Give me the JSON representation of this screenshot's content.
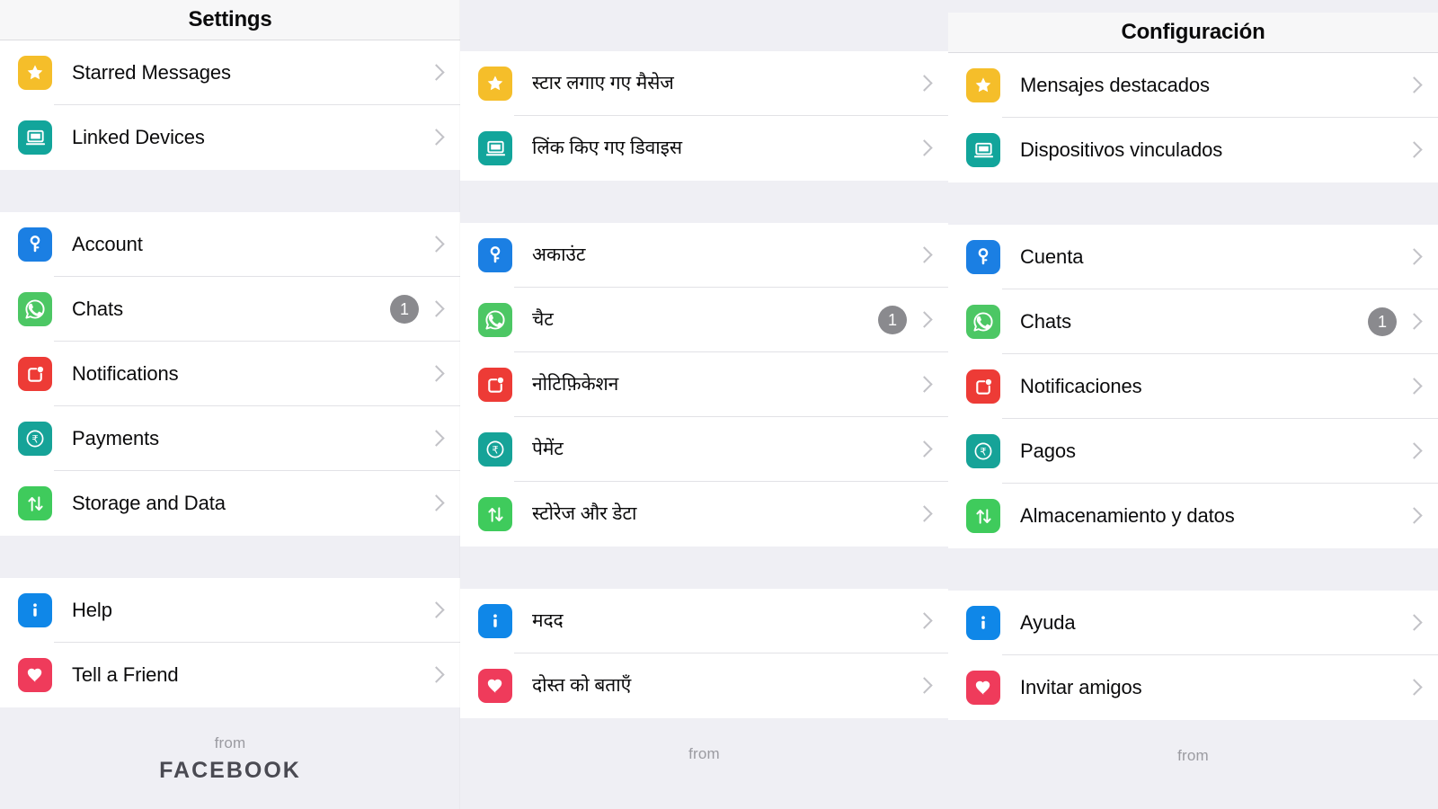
{
  "colors": {
    "page_background": "#EFEFF4",
    "row_background": "#FFFFFF",
    "separator": "#E2E2E6",
    "label_text": "#0B0B0C",
    "chevron": "#C2C2C7",
    "badge_background": "#8A8A8E",
    "badge_text": "#FFFFFF",
    "footer_from_text": "#9B9BA1",
    "footer_brand_text": "#4A4A52",
    "icon_star": "#F5BE2A",
    "icon_linked_devices": "#12A59B",
    "icon_account": "#1B7FE3",
    "icon_chats": "#4CC764",
    "icon_notifications": "#ED3B36",
    "icon_payments": "#16A398",
    "icon_storage": "#3FCB5C",
    "icon_help": "#0F87E8",
    "icon_tell_a_friend": "#EF3B5B"
  },
  "panels": [
    {
      "id": "english",
      "language": "English",
      "title": "Settings",
      "title_visible": true,
      "groups": [
        {
          "id": "group-top",
          "rows": [
            {
              "icon": "star-icon",
              "label": "Starred Messages",
              "badge": null,
              "chevron": true
            },
            {
              "icon": "linked-devices-icon",
              "label": "Linked Devices",
              "badge": null,
              "chevron": true
            }
          ]
        },
        {
          "id": "group-main",
          "rows": [
            {
              "icon": "key-icon",
              "label": "Account",
              "badge": null,
              "chevron": true
            },
            {
              "icon": "whatsapp-icon",
              "label": "Chats",
              "badge": "1",
              "chevron": true
            },
            {
              "icon": "notifications-icon",
              "label": "Notifications",
              "badge": null,
              "chevron": true
            },
            {
              "icon": "rupee-icon",
              "label": "Payments",
              "badge": null,
              "chevron": true
            },
            {
              "icon": "storage-icon",
              "label": "Storage and Data",
              "badge": null,
              "chevron": true
            }
          ]
        },
        {
          "id": "group-bottom",
          "rows": [
            {
              "icon": "info-icon",
              "label": "Help",
              "badge": null,
              "chevron": true
            },
            {
              "icon": "heart-icon",
              "label": "Tell a Friend",
              "badge": null,
              "chevron": true
            }
          ]
        }
      ],
      "footer": {
        "from": "from",
        "brand": "FACEBOOK"
      }
    },
    {
      "id": "hindi",
      "language": "Hindi",
      "title": "",
      "title_visible": false,
      "groups": [
        {
          "id": "group-top",
          "rows": [
            {
              "icon": "star-icon",
              "label": "स्टार लगाए गए मैसेज",
              "badge": null,
              "chevron": true
            },
            {
              "icon": "linked-devices-icon",
              "label": "लिंक किए गए डिवाइस",
              "badge": null,
              "chevron": true
            }
          ]
        },
        {
          "id": "group-main",
          "rows": [
            {
              "icon": "key-icon",
              "label": "अकाउंट",
              "badge": null,
              "chevron": true
            },
            {
              "icon": "whatsapp-icon",
              "label": "चैट",
              "badge": "1",
              "chevron": true
            },
            {
              "icon": "notifications-icon",
              "label": "नोटिफ़िकेशन",
              "badge": null,
              "chevron": true
            },
            {
              "icon": "rupee-icon",
              "label": "पेमेंट",
              "badge": null,
              "chevron": true
            },
            {
              "icon": "storage-icon",
              "label": "स्टोरेज और डेटा",
              "badge": null,
              "chevron": true
            }
          ]
        },
        {
          "id": "group-bottom",
          "rows": [
            {
              "icon": "info-icon",
              "label": "मदद",
              "badge": null,
              "chevron": true
            },
            {
              "icon": "heart-icon",
              "label": "दोस्त को बताएँ",
              "badge": null,
              "chevron": true
            }
          ]
        }
      ],
      "footer": {
        "from": "from",
        "brand": ""
      }
    },
    {
      "id": "spanish",
      "language": "Spanish",
      "title": "Configuración",
      "title_visible": true,
      "groups": [
        {
          "id": "group-top",
          "rows": [
            {
              "icon": "star-icon",
              "label": "Mensajes destacados",
              "badge": null,
              "chevron": true
            },
            {
              "icon": "linked-devices-icon",
              "label": "Dispositivos vinculados",
              "badge": null,
              "chevron": true
            }
          ]
        },
        {
          "id": "group-main",
          "rows": [
            {
              "icon": "key-icon",
              "label": "Cuenta",
              "badge": null,
              "chevron": true
            },
            {
              "icon": "whatsapp-icon",
              "label": "Chats",
              "badge": "1",
              "chevron": true
            },
            {
              "icon": "notifications-icon",
              "label": "Notificaciones",
              "badge": null,
              "chevron": true
            },
            {
              "icon": "rupee-icon",
              "label": "Pagos",
              "badge": null,
              "chevron": true
            },
            {
              "icon": "storage-icon",
              "label": "Almacenamiento y datos",
              "badge": null,
              "chevron": true
            }
          ]
        },
        {
          "id": "group-bottom",
          "rows": [
            {
              "icon": "info-icon",
              "label": "Ayuda",
              "badge": null,
              "chevron": true
            },
            {
              "icon": "heart-icon",
              "label": "Invitar amigos",
              "badge": null,
              "chevron": true
            }
          ]
        }
      ],
      "footer": {
        "from": "from",
        "brand": ""
      }
    }
  ]
}
